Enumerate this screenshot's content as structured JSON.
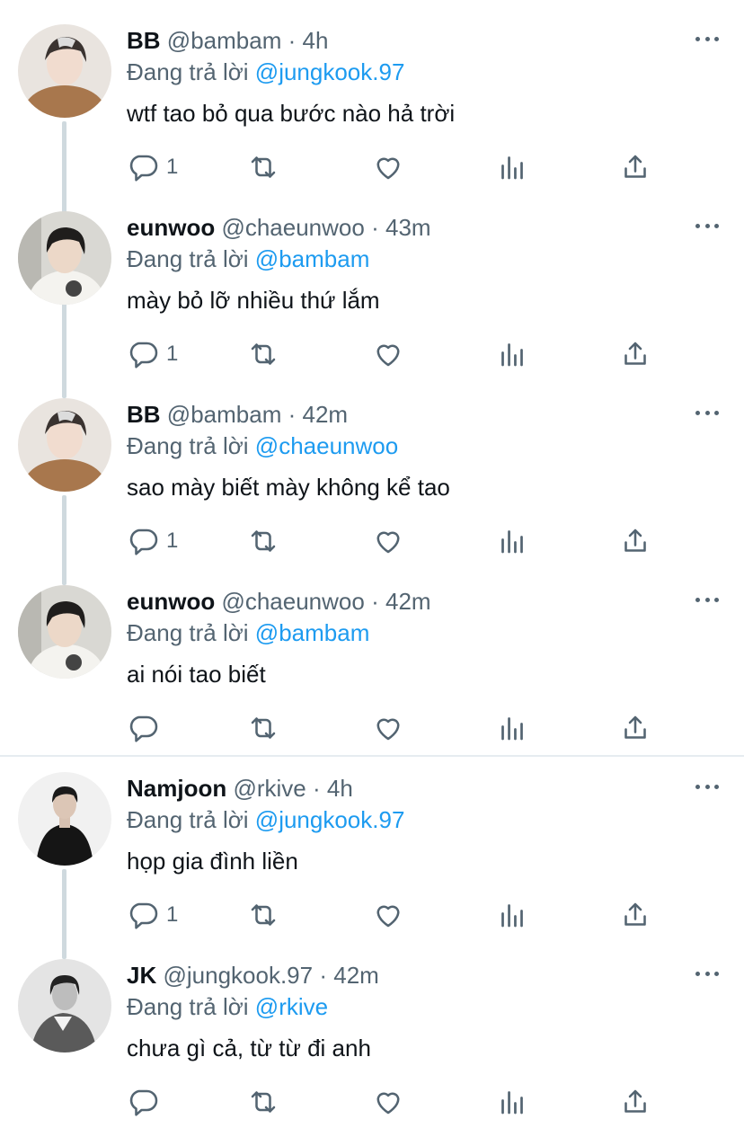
{
  "colors": {
    "text": "#0f1419",
    "secondary": "#536471",
    "mention": "#1d9bf0",
    "thread": "#cfd9de"
  },
  "tweets": [
    {
      "name": "BB",
      "handle": "@bambam",
      "dot": "·",
      "time": "4h",
      "reply_prefix": "Đang trả lời",
      "mention": "@jungkook.97",
      "text": "wtf tao bỏ qua bước nào hả trời",
      "reply_count": "1",
      "avatar": "avatar-bb"
    },
    {
      "name": "eunwoo",
      "handle": "@chaeunwoo",
      "dot": "·",
      "time": "43m",
      "reply_prefix": "Đang trả lời",
      "mention": "@bambam",
      "text": "mày bỏ lỡ nhiều thứ lắm",
      "reply_count": "1",
      "avatar": "avatar-eunwoo"
    },
    {
      "name": "BB",
      "handle": "@bambam",
      "dot": "·",
      "time": "42m",
      "reply_prefix": "Đang trả lời",
      "mention": "@chaeunwoo",
      "text": "sao mày biết mày không kể tao",
      "reply_count": "1",
      "avatar": "avatar-bb"
    },
    {
      "name": "eunwoo",
      "handle": "@chaeunwoo",
      "dot": "·",
      "time": "42m",
      "reply_prefix": "Đang trả lời",
      "mention": "@bambam",
      "text": "ai nói tao biết",
      "reply_count": "",
      "avatar": "avatar-eunwoo"
    },
    {
      "name": "Namjoon",
      "handle": "@rkive",
      "dot": "·",
      "time": "4h",
      "reply_prefix": "Đang trả lời",
      "mention": "@jungkook.97",
      "text": "họp gia đình liền",
      "reply_count": "1",
      "avatar": "avatar-namjoon"
    },
    {
      "name": "JK",
      "handle": "@jungkook.97",
      "dot": "·",
      "time": "42m",
      "reply_prefix": "Đang trả lời",
      "mention": "@rkive",
      "text": "chưa gì cả, từ từ đi anh",
      "reply_count": "",
      "avatar": "avatar-jk"
    }
  ],
  "icons": [
    "reply-icon",
    "retweet-icon",
    "like-icon",
    "analytics-icon",
    "share-icon",
    "more-icon"
  ]
}
